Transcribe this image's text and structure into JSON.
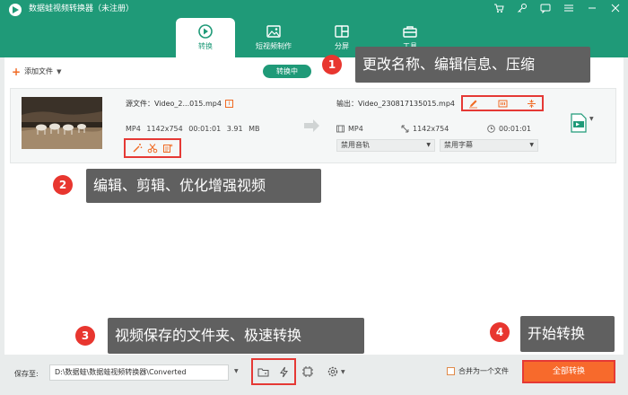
{
  "app": {
    "title": "数据蛙视频转换器（未注册）",
    "accent": "#1f9a78",
    "window_controls": [
      "cart-icon",
      "key-icon",
      "chat-icon",
      "menu-icon",
      "minimize-icon",
      "close-icon"
    ]
  },
  "tabs": [
    {
      "label": "转换",
      "icon": "convert-icon",
      "active": true
    },
    {
      "label": "短视频制作",
      "icon": "image-icon",
      "active": false
    },
    {
      "label": "分屏",
      "icon": "split-icon",
      "active": false
    },
    {
      "label": "工具",
      "icon": "toolbox-icon",
      "active": false
    }
  ],
  "toolbar": {
    "add_file": "添加文件",
    "status": "转换中"
  },
  "file": {
    "source_label": "源文件：Video_2...015.mp4",
    "source_meta": "MP4   1142x754   00:01:01   3.91 MB",
    "edit_tools": [
      "magic-wand-icon",
      "scissors-icon",
      "enhance-icon"
    ],
    "output_label": "输出：Video_230817135015.mp4",
    "output_tools": [
      "pencil-icon",
      "info-icon",
      "compress-icon"
    ],
    "output_format": "MP4",
    "output_resolution": "1142x754",
    "output_duration": "00:01:01",
    "audio_select": "禁用音轨",
    "subtitle_select": "禁用字幕"
  },
  "callouts": [
    {
      "num": "1",
      "text": "更改名称、编辑信息、压缩"
    },
    {
      "num": "2",
      "text": "编辑、剪辑、优化增强视频"
    },
    {
      "num": "3",
      "text": "视频保存的文件夹、极速转换"
    },
    {
      "num": "4",
      "text": "开始转换"
    }
  ],
  "bottom": {
    "save_to_label": "保存至:",
    "save_path": "D:\\数据蛙\\数据蛙视频转换器\\Converted",
    "merge_label": "合并为一个文件",
    "convert_all": "全部转换"
  }
}
